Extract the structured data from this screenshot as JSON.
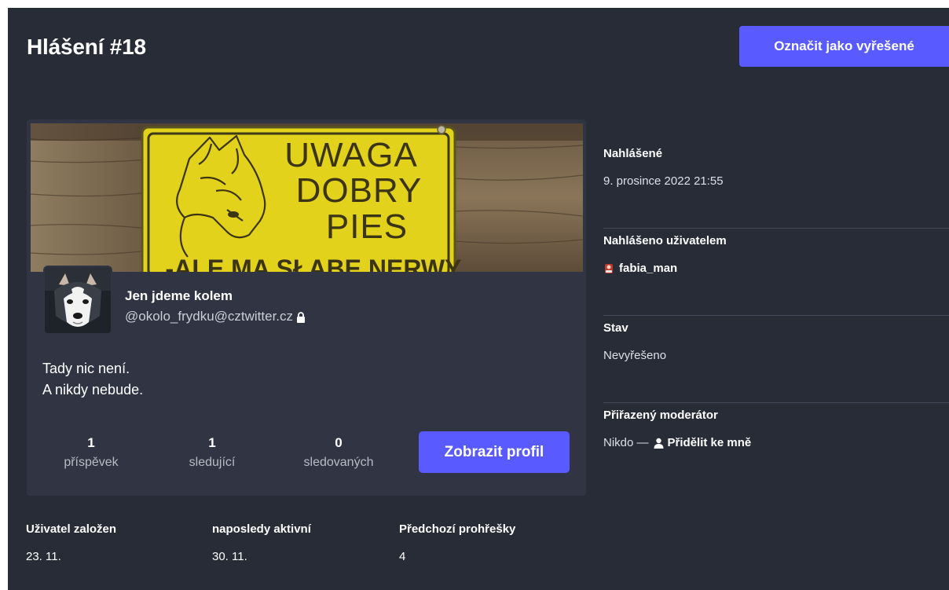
{
  "report": {
    "title": "Hlášení #18",
    "resolve_label": "Označit jako vyřešené"
  },
  "profile": {
    "header_sign_lines": [
      "UWAGA",
      "DOBRY",
      "PIES",
      "-ALE MA SŁABE NERWY"
    ],
    "display_name": "Jen jdeme kolem",
    "acct": "@okolo_frydku@cztwitter.cz",
    "bio": [
      "Tady nic není.",
      "A nikdy nebude."
    ],
    "stats": [
      {
        "value": "1",
        "label": "příspěvek"
      },
      {
        "value": "1",
        "label": "sledující"
      },
      {
        "value": "0",
        "label": "sledovaných"
      }
    ],
    "view_profile_label": "Zobrazit profil"
  },
  "meta": {
    "reported_label": "Nahlášené",
    "reported_value": "9. prosince 2022 21:55",
    "reporter_label": "Nahlášeno uživatelem",
    "reporter_value": "fabia_man",
    "status_label": "Stav",
    "status_value": "Nevyřešeno",
    "moderator_label": "Přiřazený moderátor",
    "moderator_value": "Nikdo —",
    "assign_label": "Přidělit ke mně"
  },
  "account_stats": [
    {
      "label": "Uživatel založen",
      "value": "23. 11."
    },
    {
      "label": "naposledy aktivní",
      "value": "30. 11."
    },
    {
      "label": "Předchozí prohřešky",
      "value": "4"
    }
  ],
  "colors": {
    "background": "#282c37",
    "card": "#313543",
    "accent": "#595aff",
    "sign_yellow": "#e3d21b"
  },
  "icons": {
    "lock": "lock-icon",
    "reporter_avatar": "reporter-avatar-icon",
    "user": "user-icon"
  }
}
